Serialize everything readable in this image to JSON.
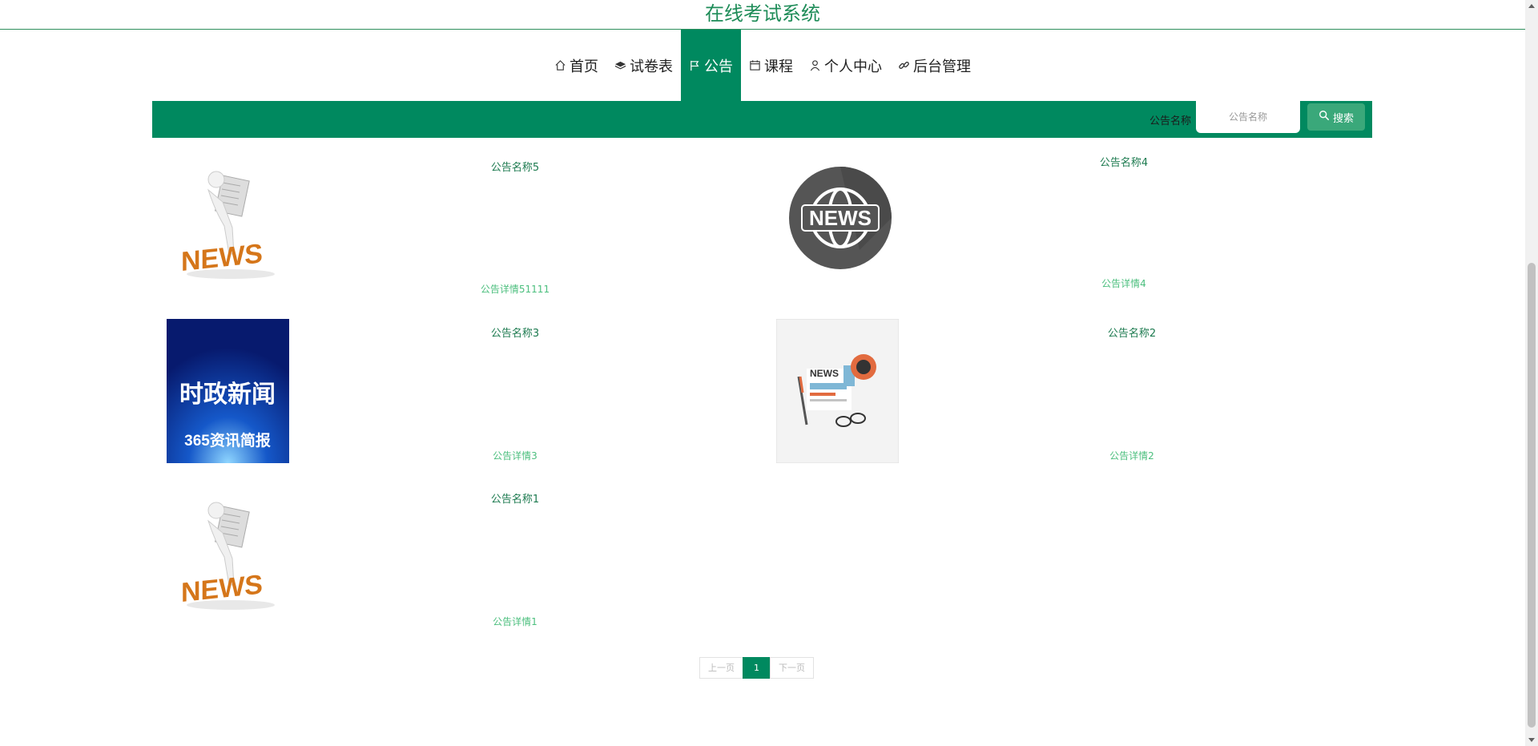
{
  "site": {
    "title": "在线考试系统"
  },
  "nav": {
    "items": [
      {
        "label": "首页",
        "icon": "home-icon",
        "active": false
      },
      {
        "label": "试卷表",
        "icon": "layers-icon",
        "active": false
      },
      {
        "label": "公告",
        "icon": "flag-icon",
        "active": true
      },
      {
        "label": "课程",
        "icon": "calendar-icon",
        "active": false
      },
      {
        "label": "个人中心",
        "icon": "user-icon",
        "active": false
      },
      {
        "label": "后台管理",
        "icon": "link-icon",
        "active": false
      }
    ]
  },
  "search": {
    "label": "公告名称",
    "placeholder": "公告名称",
    "button_label": "搜索"
  },
  "notices": [
    {
      "title": "公告名称5",
      "detail": "公告详情51111",
      "image": "news-figure-image"
    },
    {
      "title": "公告名称4",
      "detail": "公告详情4",
      "image": "news-globe-image"
    },
    {
      "title": "公告名称3",
      "detail": "公告详情3",
      "image": "political-news-image",
      "image_text_main": "时政新闻",
      "image_text_sub": "365资讯简报"
    },
    {
      "title": "公告名称2",
      "detail": "公告详情2",
      "image": "news-flat-image"
    },
    {
      "title": "公告名称1",
      "detail": "公告详情1",
      "image": "news-figure-image"
    }
  ],
  "pagination": {
    "prev": "上一页",
    "current": "1",
    "next": "下一页"
  },
  "colors": {
    "primary": "#00895f",
    "title": "#1e8c58",
    "detail": "#4cbf7e"
  }
}
